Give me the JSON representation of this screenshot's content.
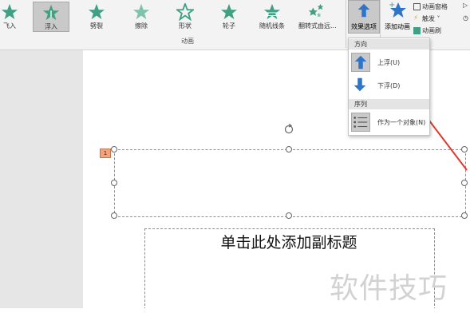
{
  "ribbon": {
    "animations": [
      {
        "label": "飞入",
        "selected": false
      },
      {
        "label": "浮入",
        "selected": true
      },
      {
        "label": "劈裂",
        "selected": false
      },
      {
        "label": "擦除",
        "selected": false
      },
      {
        "label": "形状",
        "selected": false
      },
      {
        "label": "轮子",
        "selected": false
      },
      {
        "label": "随机线条",
        "selected": false
      },
      {
        "label": "翻转式由远...",
        "selected": false
      }
    ],
    "group_label": "动画",
    "effect_options_label": "效果选项",
    "add_animation_label": "添加动画",
    "animation_pane_label": "动画窗格",
    "trigger_label": "触发",
    "animation_painter_label": "动画刷",
    "right_cut_1": "▷",
    "right_cut_2": "◷"
  },
  "dropdown": {
    "direction_header": "方向",
    "float_up_label": "上浮(U)",
    "float_down_label": "下浮(D)",
    "sequence_header": "序列",
    "as_one_object_label": "作为一个对象(N)"
  },
  "slide": {
    "animation_number": "1",
    "subtitle_placeholder": "单击此处添加副标题"
  },
  "watermark": "软件技巧",
  "colors": {
    "star": "#3fa084",
    "accent_blue": "#2e75c9",
    "arrow_red": "#e03a2f"
  }
}
